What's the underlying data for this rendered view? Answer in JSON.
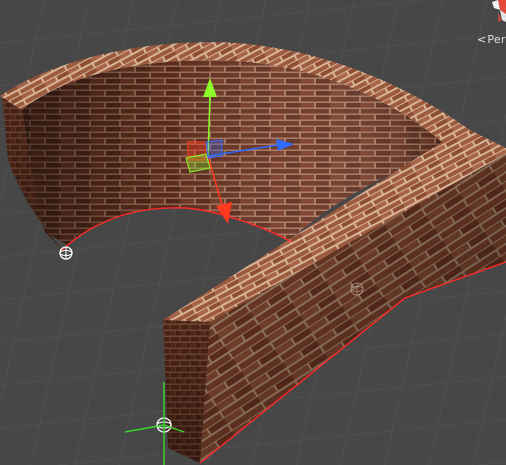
{
  "viewport": {
    "projection_label": "Persp",
    "projection_chevron": "<",
    "background_color": "#474747",
    "grid_color": "#5a5a5a"
  },
  "scene": {
    "object_name": "curved-brick-wall",
    "material": "brick",
    "brick_color": "#8a4a32",
    "mortar_color": "#c9a58a",
    "selection_outline_color": "#ff2a2a"
  },
  "transform_gizmo": {
    "axis_x_color": "#2f6bff",
    "axis_y_color": "#8cff2a",
    "axis_z_color": "#ff3a1e",
    "handles": [
      "x-axis-arrow",
      "y-axis-arrow",
      "z-axis-arrow",
      "xy-plane-handle",
      "yz-plane-handle",
      "xz-plane-handle"
    ]
  },
  "icons": {
    "orientation_gizmo": "scene-orientation-gizmo-icon",
    "pivot_markers": [
      "pivot-marker-icon",
      "pivot-marker-icon",
      "pivot-marker-icon"
    ]
  }
}
